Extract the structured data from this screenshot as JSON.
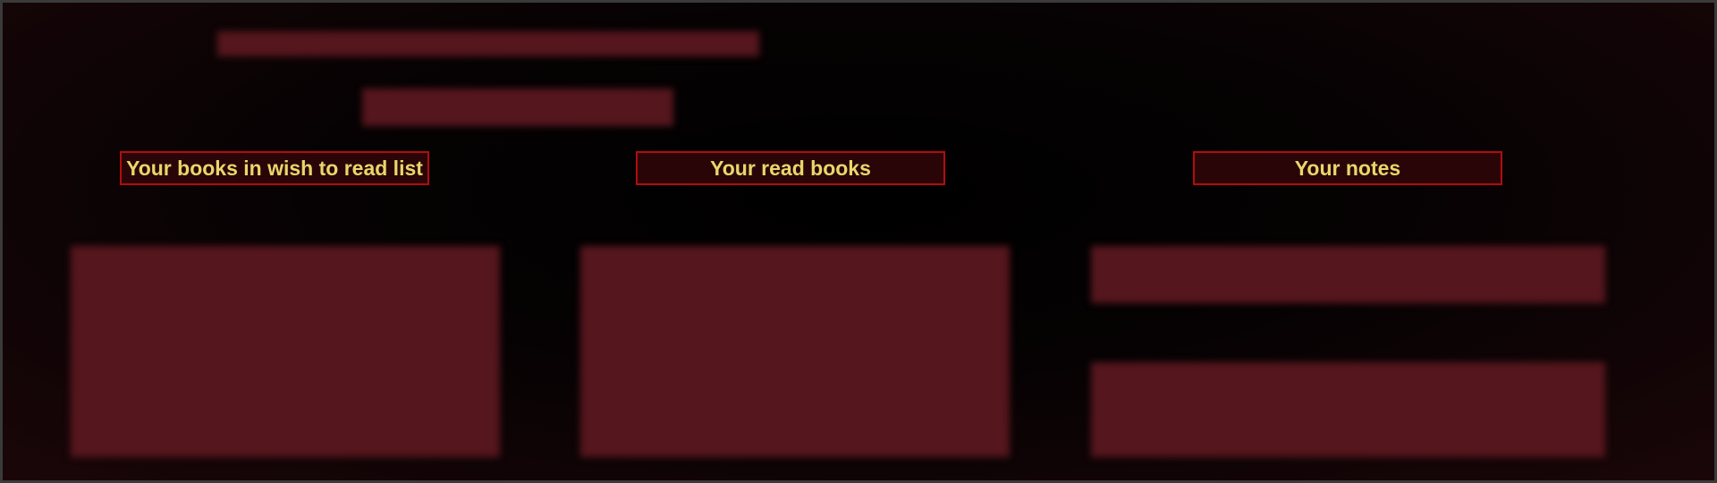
{
  "header": {
    "title_placeholder": "",
    "subtitle_placeholder": ""
  },
  "sections": {
    "wish_list": {
      "label": "Your books in wish to read list"
    },
    "read_books": {
      "label": "Your read books"
    },
    "notes": {
      "label": "Your notes"
    }
  },
  "colors": {
    "background": "#000000",
    "panel": "#55161d",
    "heading_border": "#b30c0c",
    "heading_text": "#e8d76a",
    "heading_bg": "#2a0508"
  }
}
